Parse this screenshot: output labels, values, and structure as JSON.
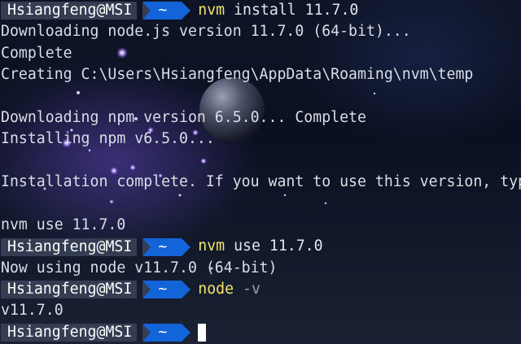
{
  "prompt": {
    "user_host": "Hsiangfeng@MSI",
    "dir": "~"
  },
  "lines": [
    {
      "type": "prompt",
      "cmd": "nvm",
      "args": "install 11.7.0",
      "flag": ""
    },
    {
      "type": "text",
      "text": "Downloading node.js version 11.7.0 (64-bit)..."
    },
    {
      "type": "text",
      "text": "Complete"
    },
    {
      "type": "text",
      "text": "Creating C:\\Users\\Hsiangfeng\\AppData\\Roaming\\nvm\\temp"
    },
    {
      "type": "text",
      "text": ""
    },
    {
      "type": "text",
      "text": "Downloading npm version 6.5.0... Complete"
    },
    {
      "type": "text",
      "text": "Installing npm v6.5.0..."
    },
    {
      "type": "text",
      "text": ""
    },
    {
      "type": "text",
      "text": "Installation complete. If you want to use this version, type"
    },
    {
      "type": "text",
      "text": ""
    },
    {
      "type": "text",
      "text": "nvm use 11.7.0"
    },
    {
      "type": "prompt",
      "cmd": "nvm",
      "args": "use 11.7.0",
      "flag": ""
    },
    {
      "type": "text",
      "text": "Now using node v11.7.0 (64-bit)"
    },
    {
      "type": "prompt",
      "cmd": "node",
      "args": "",
      "flag": "-v"
    },
    {
      "type": "text",
      "text": "v11.7.0"
    },
    {
      "type": "prompt",
      "cmd": "",
      "args": "",
      "flag": "",
      "cursor": true
    }
  ],
  "colors": {
    "command": "#f3e36a",
    "output": "#d9dde6",
    "flag": "#9aa1b3",
    "prompt_user_bg": "#343d52",
    "prompt_dir_bg": "#1264d8",
    "background": "#0b1020"
  }
}
